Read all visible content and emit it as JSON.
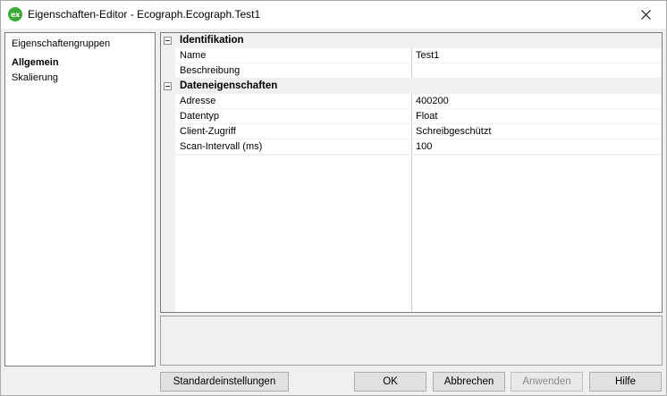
{
  "window": {
    "title": "Eigenschaften-Editor - Ecograph.Ecograph.Test1",
    "app_icon_text": "ex"
  },
  "sidebar": {
    "header": "Eigenschaftengruppen",
    "items": [
      {
        "label": "Allgemein",
        "selected": true
      },
      {
        "label": "Skalierung",
        "selected": false
      }
    ]
  },
  "grid": {
    "categories": [
      {
        "label": "Identifikation",
        "properties": [
          {
            "name": "Name",
            "value": "Test1"
          },
          {
            "name": "Beschreibung",
            "value": ""
          }
        ]
      },
      {
        "label": "Dateneigenschaften",
        "properties": [
          {
            "name": "Adresse",
            "value": "400200"
          },
          {
            "name": "Datentyp",
            "value": "Float"
          },
          {
            "name": "Client-Zugriff",
            "value": "Schreibgeschützt"
          },
          {
            "name": "Scan-Intervall (ms)",
            "value": "100"
          }
        ]
      }
    ]
  },
  "buttons": {
    "defaults": "Standardeinstellungen",
    "ok": "OK",
    "cancel": "Abbrechen",
    "apply": "Anwenden",
    "help": "Hilfe"
  },
  "colors": {
    "app_icon": "#3aa935",
    "window_bg": "#f0f0f0"
  }
}
